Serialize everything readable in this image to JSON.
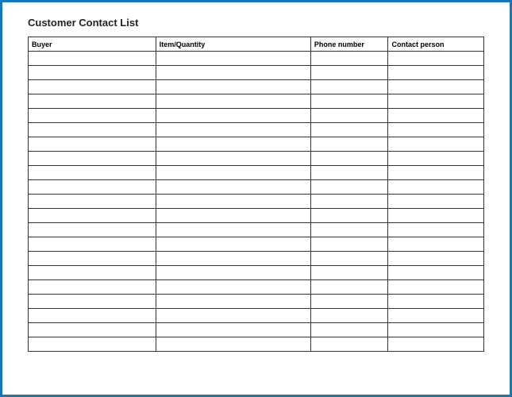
{
  "title": "Customer Contact List",
  "columns": {
    "buyer": "Buyer",
    "item_quantity": "Item/Quantity",
    "phone_number": "Phone number",
    "contact_person": "Contact person"
  },
  "rows": [
    {
      "buyer": "",
      "item_quantity": "",
      "phone_number": "",
      "contact_person": ""
    },
    {
      "buyer": "",
      "item_quantity": "",
      "phone_number": "",
      "contact_person": ""
    },
    {
      "buyer": "",
      "item_quantity": "",
      "phone_number": "",
      "contact_person": ""
    },
    {
      "buyer": "",
      "item_quantity": "",
      "phone_number": "",
      "contact_person": ""
    },
    {
      "buyer": "",
      "item_quantity": "",
      "phone_number": "",
      "contact_person": ""
    },
    {
      "buyer": "",
      "item_quantity": "",
      "phone_number": "",
      "contact_person": ""
    },
    {
      "buyer": "",
      "item_quantity": "",
      "phone_number": "",
      "contact_person": ""
    },
    {
      "buyer": "",
      "item_quantity": "",
      "phone_number": "",
      "contact_person": ""
    },
    {
      "buyer": "",
      "item_quantity": "",
      "phone_number": "",
      "contact_person": ""
    },
    {
      "buyer": "",
      "item_quantity": "",
      "phone_number": "",
      "contact_person": ""
    },
    {
      "buyer": "",
      "item_quantity": "",
      "phone_number": "",
      "contact_person": ""
    },
    {
      "buyer": "",
      "item_quantity": "",
      "phone_number": "",
      "contact_person": ""
    },
    {
      "buyer": "",
      "item_quantity": "",
      "phone_number": "",
      "contact_person": ""
    },
    {
      "buyer": "",
      "item_quantity": "",
      "phone_number": "",
      "contact_person": ""
    },
    {
      "buyer": "",
      "item_quantity": "",
      "phone_number": "",
      "contact_person": ""
    },
    {
      "buyer": "",
      "item_quantity": "",
      "phone_number": "",
      "contact_person": ""
    },
    {
      "buyer": "",
      "item_quantity": "",
      "phone_number": "",
      "contact_person": ""
    },
    {
      "buyer": "",
      "item_quantity": "",
      "phone_number": "",
      "contact_person": ""
    },
    {
      "buyer": "",
      "item_quantity": "",
      "phone_number": "",
      "contact_person": ""
    },
    {
      "buyer": "",
      "item_quantity": "",
      "phone_number": "",
      "contact_person": ""
    },
    {
      "buyer": "",
      "item_quantity": "",
      "phone_number": "",
      "contact_person": ""
    }
  ]
}
